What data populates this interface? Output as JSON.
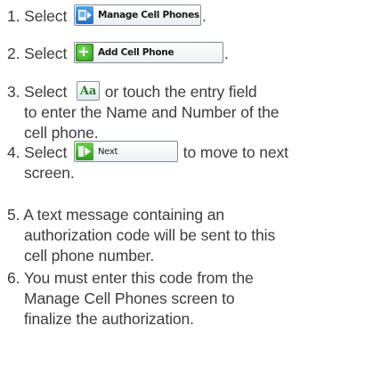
{
  "steps": [
    {
      "num": "1.",
      "pre": "Select",
      "button": "Manage Cell Phones",
      "post": "."
    },
    {
      "num": "2.",
      "pre": "Select",
      "button": "Add Cell Phone",
      "post": "."
    },
    {
      "num": "3.",
      "pre": "Select",
      "icon_label": "Aa",
      "post": "or touch the entry field",
      "lines": [
        "to enter the Name and Number of the",
        "cell phone."
      ]
    },
    {
      "num": "4.",
      "pre": "Select",
      "button": "Next",
      "post": "to move to next",
      "lines": [
        "screen."
      ]
    },
    {
      "num": "5.",
      "text": "A text message containing an",
      "lines": [
        "authorization code will be sent to this",
        "cell phone number."
      ]
    },
    {
      "num": "6.",
      "text": "You must enter this code from the",
      "lines": [
        "Manage Cell Phones screen to",
        "finalize the authorization."
      ]
    }
  ],
  "icons": {
    "manage": "phone-screen-icon",
    "add": "plus-circle-icon",
    "text_entry": "text-entry-icon",
    "next": "next-arrow-icon"
  },
  "colors": {
    "text": "#3c3c3c",
    "manage_icon": "#2a7fd6",
    "add_icon": "#3cb02a",
    "next_icon": "#3cb02a"
  }
}
